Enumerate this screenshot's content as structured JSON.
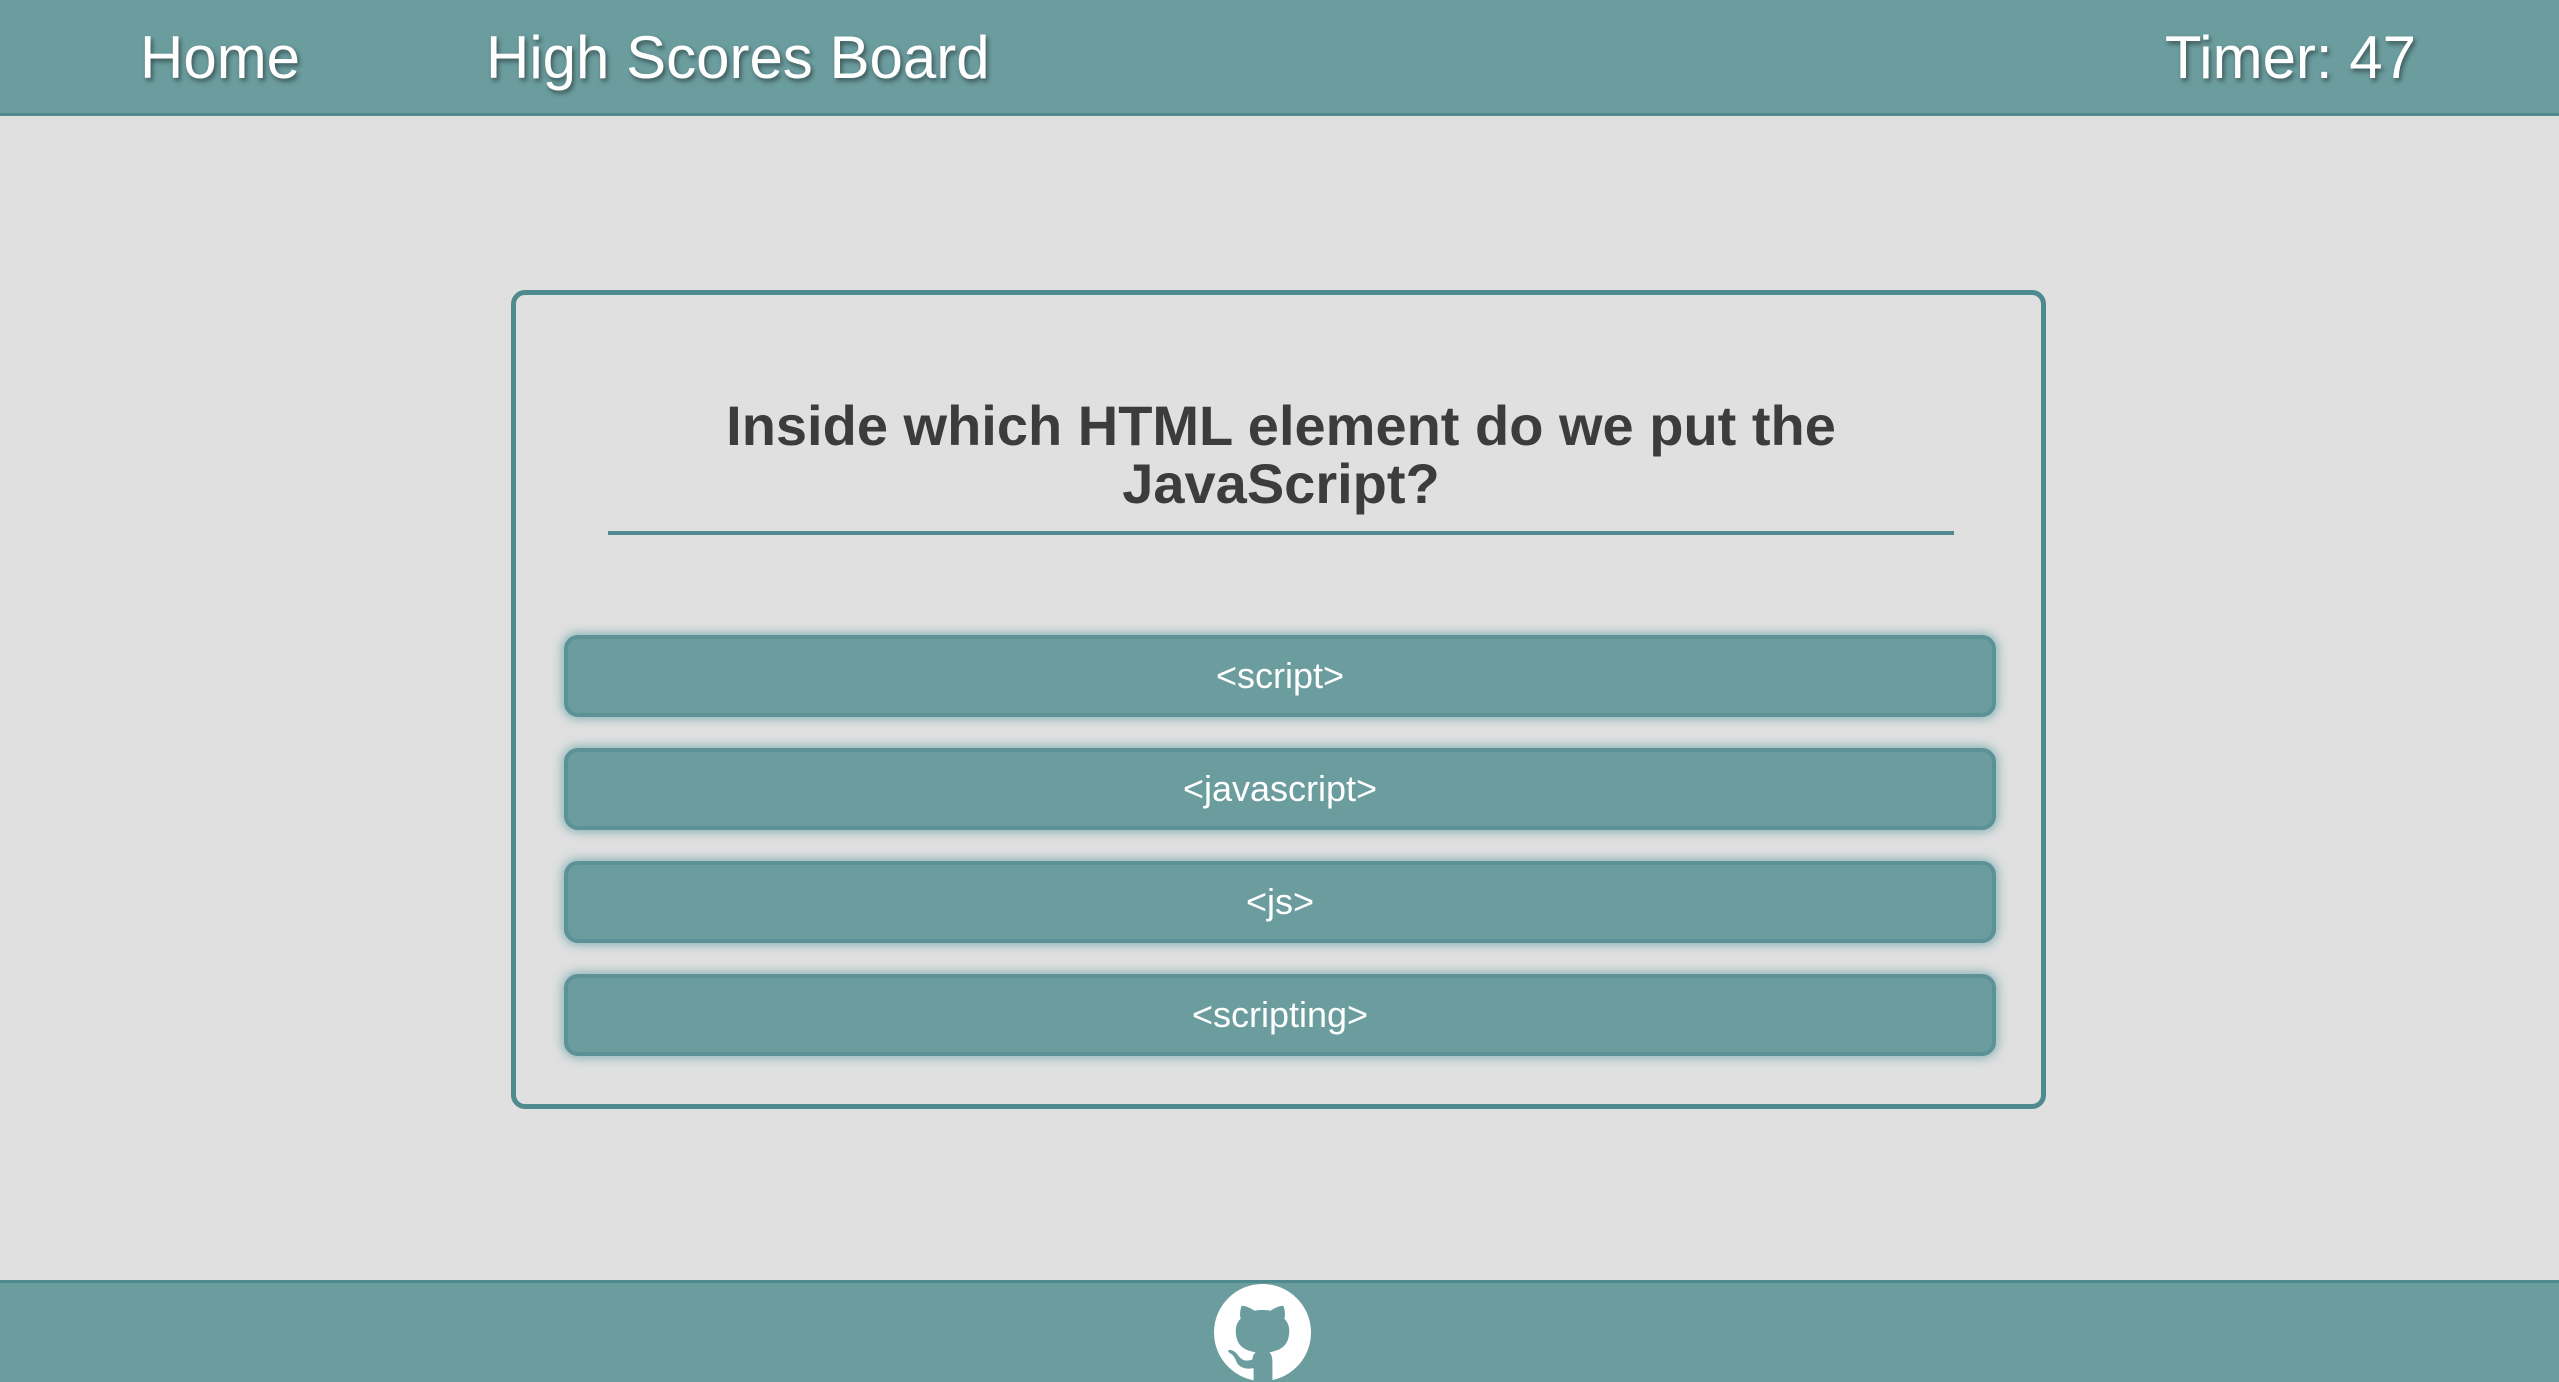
{
  "nav": {
    "home_label": "Home",
    "highscores_label": "High Scores Board"
  },
  "timer": {
    "label": "Timer: 47"
  },
  "quiz": {
    "question": "Inside which HTML element do we put the JavaScript?",
    "answers": [
      {
        "label": "<script>"
      },
      {
        "label": "<javascript>"
      },
      {
        "label": "<js>"
      },
      {
        "label": "<scripting>"
      }
    ]
  },
  "footer": {
    "icon": "github-icon"
  },
  "colors": {
    "bar": "#6b9c9e",
    "accent": "#4e8a8e",
    "background": "#e0e0e0",
    "question_text": "#3c3c3c"
  }
}
